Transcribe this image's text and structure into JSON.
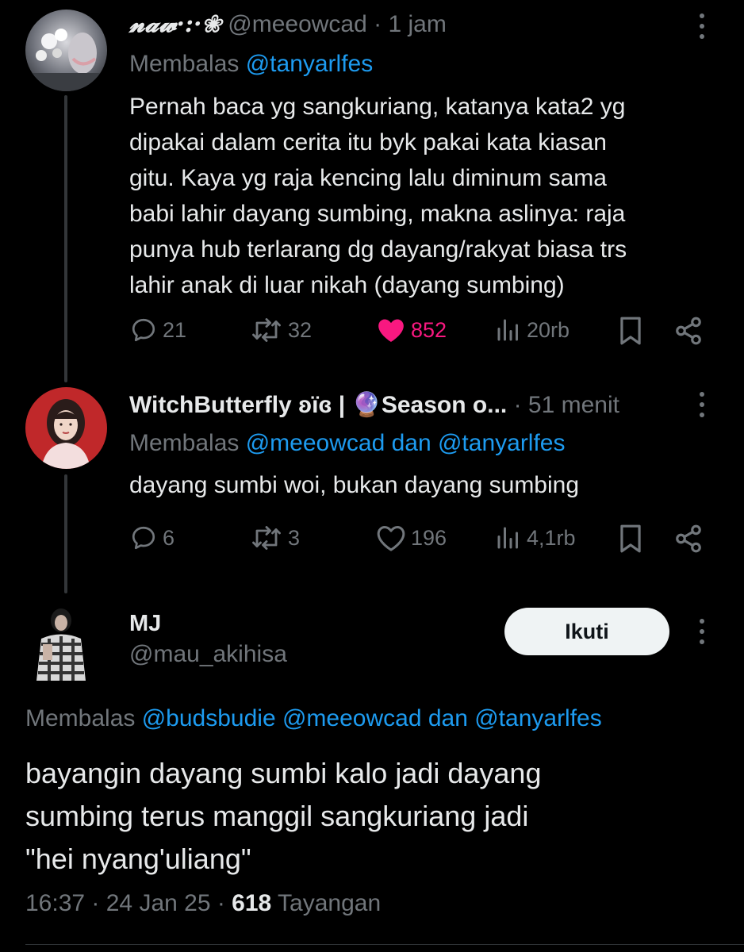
{
  "tweet1": {
    "display_name": "𝓷𝓪𝔀·:·❀",
    "handle": "@meeowcad",
    "separator": " · ",
    "time": "1 jam",
    "reply_label": "Membalas ",
    "reply_mentions": "@tanyarlfes",
    "text_lines": [
      "Pernah baca yg sangkuriang, katanya kata2 yg",
      "dipakai dalam cerita itu byk pakai kata kiasan",
      "gitu. Kaya yg raja kencing lalu diminum sama",
      "babi lahir dayang sumbing, makna aslinya: raja",
      "punya hub terlarang dg dayang/rakyat biasa trs",
      "lahir anak di luar nikah (dayang sumbing)"
    ],
    "replies": "21",
    "reposts": "32",
    "likes": "852",
    "views": "20rb",
    "liked": true
  },
  "tweet2": {
    "display_name": "WitchButterfly ʚïɞ | 🔮Season o...",
    "separator": " · ",
    "time": "51 menit",
    "reply_label": "Membalas ",
    "reply_mentions": "@meeowcad dan @tanyarlfes",
    "text": "dayang sumbi woi, bukan dayang sumbing",
    "replies": "6",
    "reposts": "3",
    "likes": "196",
    "views": "4,1rb"
  },
  "tweet3": {
    "display_name": "MJ",
    "handle": "@mau_akihisa",
    "follow_label": "Ikuti",
    "reply_label": "Membalas ",
    "reply_mentions": "@budsbudie @meeowcad dan @tanyarlfes",
    "text_lines": [
      "bayangin dayang sumbi kalo jadi dayang",
      "sumbing terus manggil sangkuriang jadi",
      "\"hei nyang'uliang\""
    ],
    "timestamp": "16:37 · 24 Jan 25 · ",
    "views_count": "618",
    "views_label": " Tayangan"
  },
  "colors": {
    "background": "#000000",
    "text": "#e7e9ea",
    "muted": "#71767b",
    "link": "#1d9bf0",
    "like": "#f91880"
  },
  "icons": [
    "reply-icon",
    "repost-icon",
    "like-icon",
    "views-icon",
    "bookmark-icon",
    "share-icon",
    "more-icon"
  ]
}
